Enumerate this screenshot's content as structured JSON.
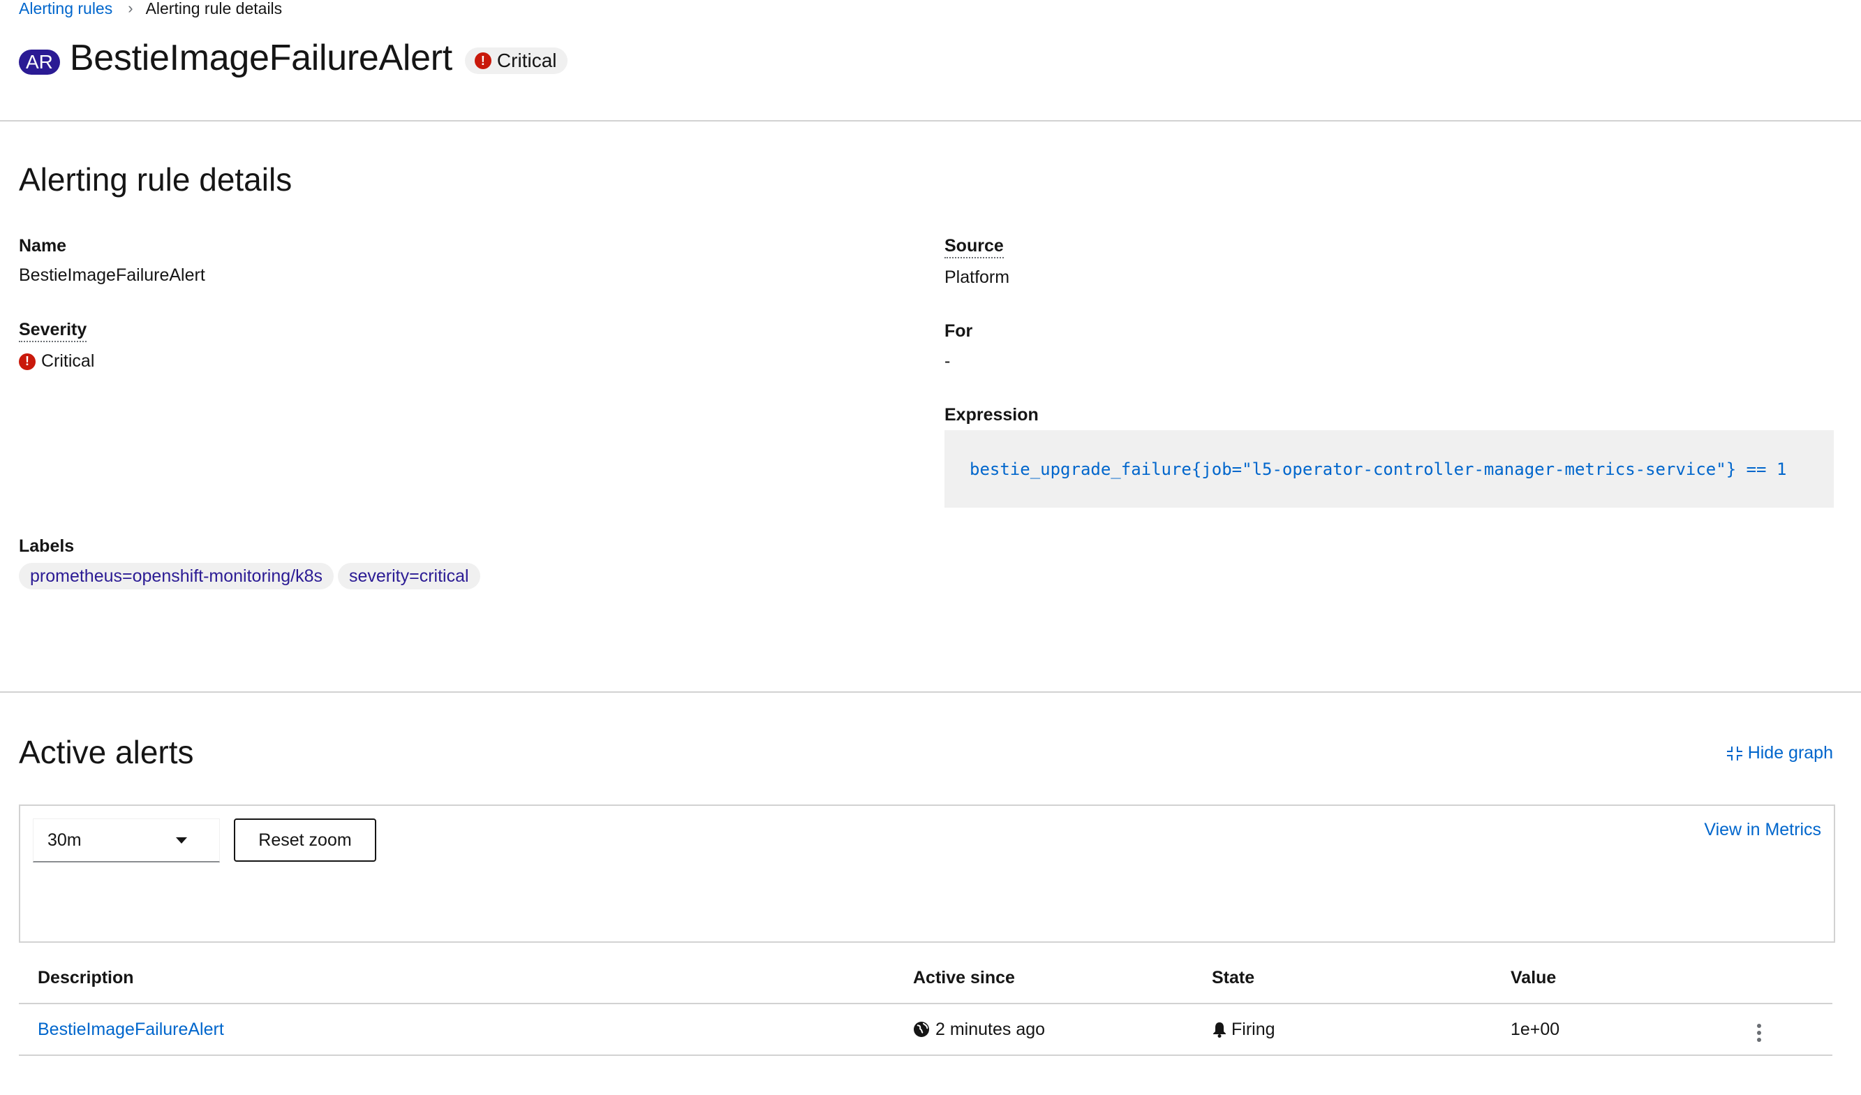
{
  "breadcrumb": {
    "parent": "Alerting rules",
    "current": "Alerting rule details"
  },
  "header": {
    "badge": "AR",
    "title": "BestieImageFailureAlert",
    "severity": "Critical"
  },
  "details": {
    "heading": "Alerting rule details",
    "name_label": "Name",
    "name_value": "BestieImageFailureAlert",
    "severity_label": "Severity",
    "severity_value": "Critical",
    "source_label": "Source",
    "source_value": "Platform",
    "for_label": "For",
    "for_value": "-",
    "expression_label": "Expression",
    "expression_value": "bestie_upgrade_failure{job=\"l5-operator-controller-manager-metrics-service\"} == 1",
    "labels_label": "Labels",
    "labels": [
      "prometheus=openshift-monitoring/k8s",
      "severity=critical"
    ]
  },
  "active_alerts": {
    "heading": "Active alerts",
    "hide_graph": "Hide graph",
    "timespan": "30m",
    "reset_zoom": "Reset zoom",
    "view_in_metrics": "View in Metrics",
    "columns": [
      "Description",
      "Active since",
      "State",
      "Value"
    ],
    "rows": [
      {
        "description": "BestieImageFailureAlert",
        "active_since": "2 minutes ago",
        "state": "Firing",
        "value": "1e+00"
      }
    ]
  },
  "colors": {
    "link": "#0066cc",
    "critical": "#c9190b",
    "badge": "#2b1b94",
    "divider": "#d2d2d2"
  },
  "icons": [
    "chevron-right-icon",
    "exclamation-circle-icon",
    "compress-icon",
    "caret-down-icon",
    "globe-icon",
    "bell-icon",
    "kebab-icon"
  ]
}
